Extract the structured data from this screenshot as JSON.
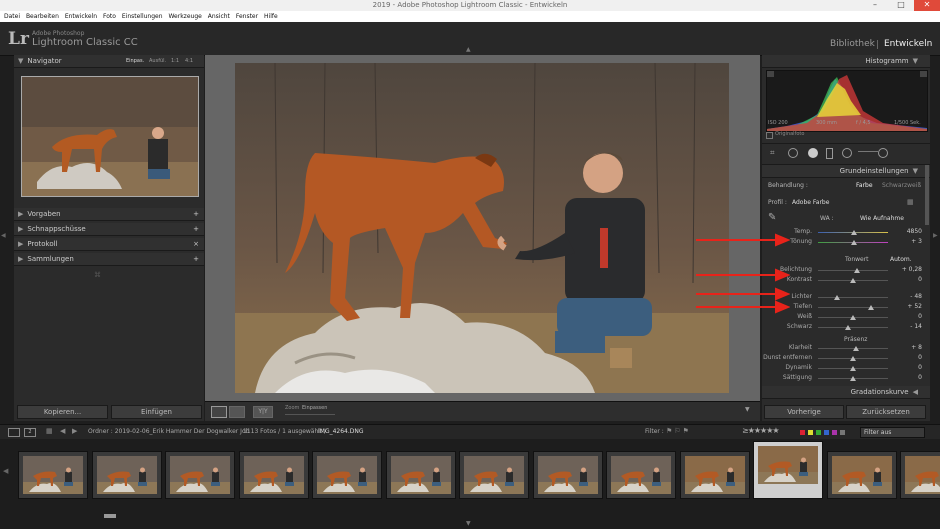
{
  "window": {
    "title": "2019 - Adobe Photoshop Lightroom Classic - Entwickeln"
  },
  "menu": [
    "Datei",
    "Bearbeiten",
    "Entwickeln",
    "Foto",
    "Einstellungen",
    "Werkzeuge",
    "Ansicht",
    "Fenster",
    "Hilfe"
  ],
  "identity": {
    "logo": "Lr",
    "brand_small": "Adobe Photoshop",
    "brand_big": "Lightroom Classic CC",
    "modules": [
      "Bibliothek",
      "Entwickeln"
    ],
    "active_module": "Entwickeln"
  },
  "left": {
    "navigator": {
      "title": "Navigator",
      "zoom_options": [
        "Einpas.",
        "Ausfül.",
        "1:1",
        "4:1"
      ]
    },
    "sections": [
      "Vorgaben",
      "Schnappschüsse",
      "Protokoll",
      "Sammlungen"
    ],
    "copy_button": "Kopieren...",
    "paste_button": "Einfügen"
  },
  "toolbar": {
    "zoom_label": "Zoom",
    "zoom_value": "Einpassen"
  },
  "right": {
    "histogram": {
      "title": "Histogramm",
      "info": [
        "ISO 200",
        "300 mm",
        "f / 4,5",
        "1/500 Sek."
      ],
      "original_photo": "Originalfoto"
    },
    "basic": {
      "title": "Grundeinstellungen",
      "treatment_label": "Behandlung :",
      "treatment_options": [
        "Farbe",
        "Schwarzweiß"
      ],
      "profile_label": "Profil :",
      "profile_value": "Adobe Farbe",
      "wb_label": "WA :",
      "wb_value": "Wie Aufnahme",
      "tone_label": "Tonwert",
      "auto_label": "Autom.",
      "presence_label": "Präsenz",
      "sliders": [
        {
          "label": "Temp.",
          "value": "4850",
          "pos": 0.52
        },
        {
          "label": "Tönung",
          "value": "+ 3",
          "pos": 0.52
        },
        {
          "label": "Belichtung",
          "value": "+ 0,28",
          "pos": 0.55
        },
        {
          "label": "Kontrast",
          "value": "0",
          "pos": 0.5
        },
        {
          "label": "Lichter",
          "value": "- 48",
          "pos": 0.27
        },
        {
          "label": "Tiefen",
          "value": "+ 52",
          "pos": 0.76
        },
        {
          "label": "Weiß",
          "value": "0",
          "pos": 0.5
        },
        {
          "label": "Schwarz",
          "value": "- 14",
          "pos": 0.43
        },
        {
          "label": "Klarheit",
          "value": "+ 8",
          "pos": 0.54
        },
        {
          "label": "Dunst entfernen",
          "value": "0",
          "pos": 0.5
        },
        {
          "label": "Dynamik",
          "value": "0",
          "pos": 0.5
        },
        {
          "label": "Sättigung",
          "value": "0",
          "pos": 0.5
        }
      ]
    },
    "next_section": "Gradationskurve",
    "previous_button": "Vorherige",
    "reset_button": "Zurücksetzen"
  },
  "filmstrip": {
    "folder_info": "Ordner : 2019-02-06_Erik Hammer Der Dogwalker Job",
    "count_info": "1113 Fotos / 1 ausgewählt /",
    "filename": "IMG_4264.DNG",
    "filter_label": "Filter :",
    "filter_value": "Filter aus"
  },
  "colors": {
    "accent_red": "#e8231a",
    "panel": "#2b2b2b",
    "background": "#1e1e1e"
  }
}
